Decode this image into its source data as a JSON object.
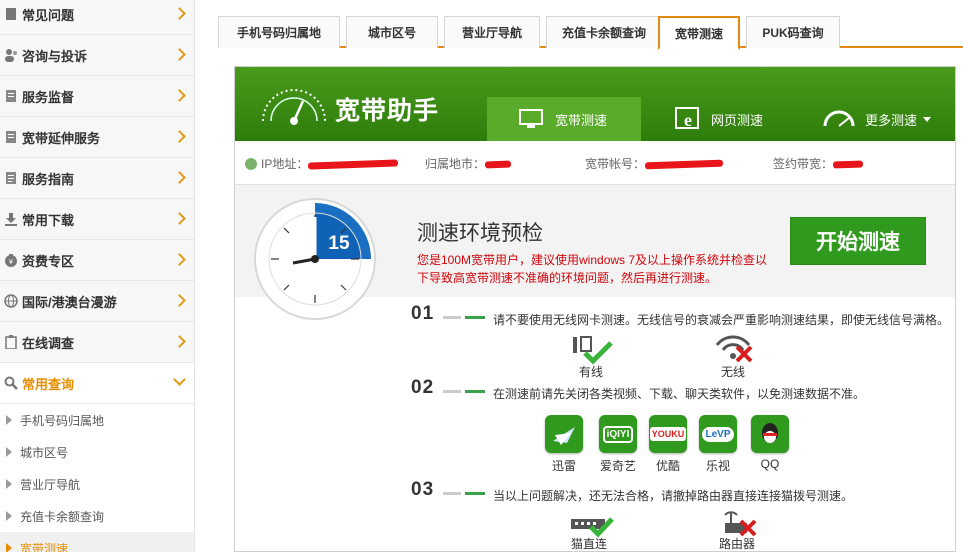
{
  "sidebar": {
    "menu": [
      {
        "label": "常见问题",
        "icon": "help-icon"
      },
      {
        "label": "咨询与投诉",
        "icon": "people-icon"
      },
      {
        "label": "服务监督",
        "icon": "document-icon"
      },
      {
        "label": "宽带延伸服务",
        "icon": "document-icon"
      },
      {
        "label": "服务指南",
        "icon": "guide-icon"
      },
      {
        "label": "常用下载",
        "icon": "download-icon"
      },
      {
        "label": "资费专区",
        "icon": "money-bag-icon"
      },
      {
        "label": "国际/港澳台漫游",
        "icon": "globe-icon"
      },
      {
        "label": "在线调查",
        "icon": "clipboard-icon"
      },
      {
        "label": "常用查询",
        "icon": "magnifier-icon"
      }
    ],
    "submenu": [
      "手机号码归属地",
      "城市区号",
      "营业厅导航",
      "充值卡余额查询",
      "宽带测速"
    ]
  },
  "tabs": [
    "手机号码归属地",
    "城市区号",
    "营业厅导航",
    "充值卡余额查询",
    "宽带测速",
    "PUK码查询"
  ],
  "banner": {
    "brand": "宽带助手",
    "tabs": [
      "宽带测速",
      "网页测速",
      "更多测速"
    ]
  },
  "info": {
    "ip_label": "IP地址：",
    "city_label": "归属地市：",
    "account_label": "宽带帐号：",
    "bandwidth_label": "签约带宽："
  },
  "check": {
    "title": "测速环境预检",
    "note": "您是100M宽带用户，建议使用windows 7及以上操作系统并检查以下导致高宽带测速不准确的环境问题，然后再进行测速。",
    "start_label": "开始测速",
    "dial_value": "15"
  },
  "steps": [
    {
      "num": "01",
      "text": "请不要使用无线网卡测速。无线信号的衰减会严重影响测速结果，即使无线信号满格。",
      "options": [
        "有线",
        "无线"
      ]
    },
    {
      "num": "02",
      "text": "在测速前请先关闭各类视频、下载、聊天类软件，以免测速数据不准。",
      "apps": [
        "迅雷",
        "爱奇艺",
        "优酷",
        "乐视",
        "QQ"
      ],
      "app_logos": [
        "iQIYI",
        "YOUKU",
        "LeVP"
      ]
    },
    {
      "num": "03",
      "text": "当以上问题解决，还无法合格，请撤掉路由器直接连接猫拨号测速。",
      "options": [
        "猫直连",
        "路由器"
      ]
    }
  ],
  "colors": {
    "brand_green": "#2f9a1d",
    "accent_orange": "#e28a14",
    "alert_red": "#d0060c"
  }
}
